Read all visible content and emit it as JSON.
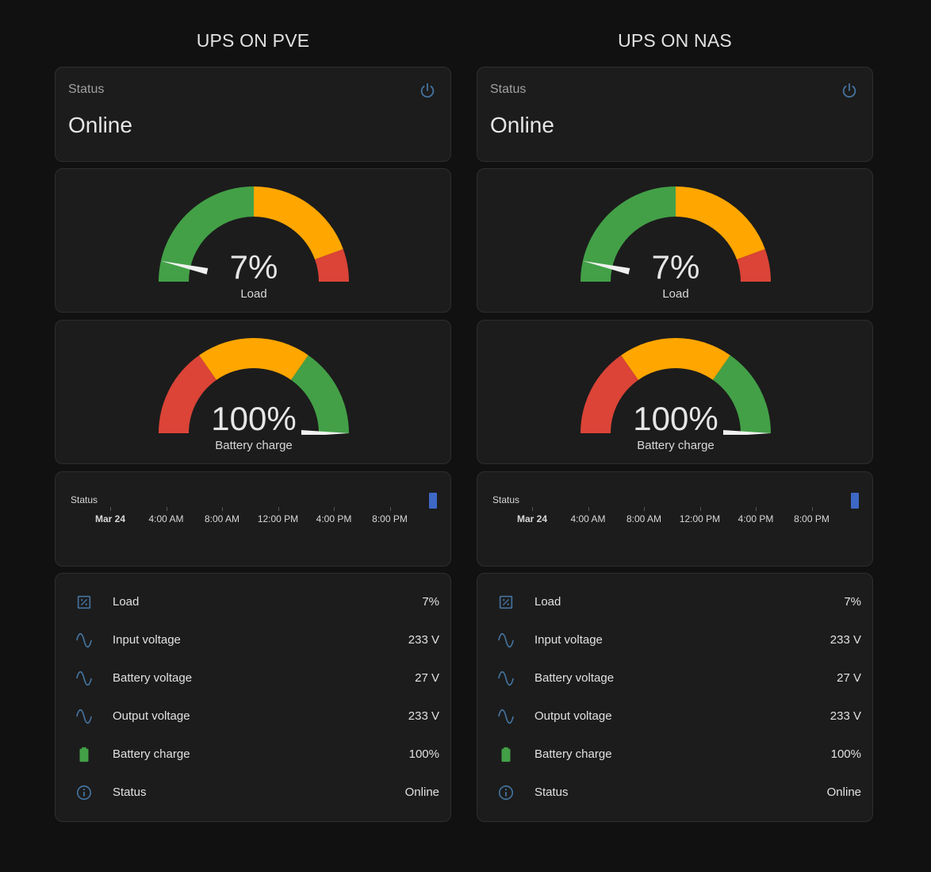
{
  "colors": {
    "background": "#111111",
    "card": "#1c1c1c",
    "green": "#43a047",
    "orange": "#ffa600",
    "red": "#db4437",
    "icon_blue": "#44739e",
    "history_bar": "#3e68c6"
  },
  "columns": [
    {
      "title": "UPS ON PVE",
      "status": {
        "label": "Status",
        "value": "Online",
        "icon": "power-icon"
      },
      "load_gauge": {
        "value_text": "7%",
        "value": 7,
        "name": "Load",
        "segments": [
          "green",
          "orange",
          "red"
        ]
      },
      "battery_gauge": {
        "value_text": "100%",
        "value": 100,
        "name": "Battery charge",
        "segments": [
          "red",
          "orange",
          "green"
        ]
      },
      "history": {
        "label": "Status",
        "ticks": [
          "Mar 24",
          "4:00 AM",
          "8:00 AM",
          "12:00 PM",
          "4:00 PM",
          "8:00 PM"
        ]
      },
      "entities": [
        {
          "icon": "percent-box-icon",
          "name": "Load",
          "value": "7%"
        },
        {
          "icon": "sine-wave-icon",
          "name": "Input voltage",
          "value": "233 V"
        },
        {
          "icon": "sine-wave-icon",
          "name": "Battery voltage",
          "value": "27 V"
        },
        {
          "icon": "sine-wave-icon",
          "name": "Output voltage",
          "value": "233 V"
        },
        {
          "icon": "battery-icon",
          "name": "Battery charge",
          "value": "100%"
        },
        {
          "icon": "info-icon",
          "name": "Status",
          "value": "Online"
        }
      ]
    },
    {
      "title": "UPS ON NAS",
      "status": {
        "label": "Status",
        "value": "Online",
        "icon": "power-icon"
      },
      "load_gauge": {
        "value_text": "7%",
        "value": 7,
        "name": "Load",
        "segments": [
          "green",
          "orange",
          "red"
        ]
      },
      "battery_gauge": {
        "value_text": "100%",
        "value": 100,
        "name": "Battery charge",
        "segments": [
          "red",
          "orange",
          "green"
        ]
      },
      "history": {
        "label": "Status",
        "ticks": [
          "Mar 24",
          "4:00 AM",
          "8:00 AM",
          "12:00 PM",
          "4:00 PM",
          "8:00 PM"
        ]
      },
      "entities": [
        {
          "icon": "percent-box-icon",
          "name": "Load",
          "value": "7%"
        },
        {
          "icon": "sine-wave-icon",
          "name": "Input voltage",
          "value": "233 V"
        },
        {
          "icon": "sine-wave-icon",
          "name": "Battery voltage",
          "value": "27 V"
        },
        {
          "icon": "sine-wave-icon",
          "name": "Output voltage",
          "value": "233 V"
        },
        {
          "icon": "battery-icon",
          "name": "Battery charge",
          "value": "100%"
        },
        {
          "icon": "info-icon",
          "name": "Status",
          "value": "Online"
        }
      ]
    }
  ]
}
